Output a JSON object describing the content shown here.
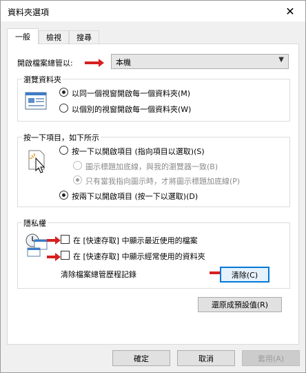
{
  "window": {
    "title": "資料夾選項",
    "close_glyph": "✕"
  },
  "tabs": [
    {
      "label": "一般",
      "active": true
    },
    {
      "label": "檢視",
      "active": false
    },
    {
      "label": "搜尋",
      "active": false
    }
  ],
  "open_with": {
    "label": "開啟檔案總管以:",
    "value": "本機"
  },
  "browse_folders": {
    "title": "瀏覽資料夾",
    "options": [
      {
        "label": "以同一個視窗開啟每一個資料夾(M)",
        "checked": true
      },
      {
        "label": "以個別的視窗開啟每一個資料夾(W)",
        "checked": false
      }
    ]
  },
  "click_items": {
    "title": "按一下項目，如下所示",
    "single_click": "按一下以開啟項目 (指向項目以選取)(S)",
    "underline_consistent": "圖示標題加底線，與我的瀏覽器一致(B)",
    "underline_on_hover": "只有當我指向圖示時，才將圖示標題加底線(P)",
    "double_click": "按兩下以開啟項目 (按一下以選取)(D)"
  },
  "privacy": {
    "title": "隱私權",
    "recent_files": "在 [快速存取] 中顯示最近使用的檔案",
    "frequent_folders": "在 [快速存取] 中顯示經常使用的資料夾",
    "clear_history_label": "清除檔案總管歷程記錄",
    "clear_button": "清除(C)"
  },
  "restore_defaults": "還原成預設值(R)",
  "footer": {
    "ok": "確定",
    "cancel": "取消",
    "apply": "套用(A)"
  },
  "colors": {
    "accent": "#0078d7",
    "annotation_arrow": "#d62020"
  }
}
